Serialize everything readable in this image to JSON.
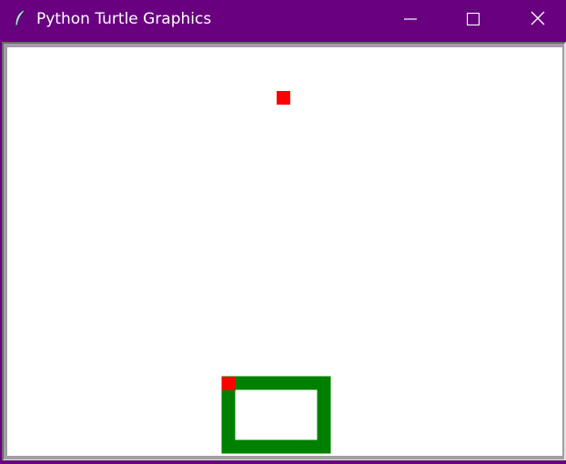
{
  "window": {
    "title": "Python Turtle Graphics",
    "frame_color": "#680080",
    "icons": {
      "app": "feather-icon",
      "minimize": "minimize-icon",
      "maximize": "maximize-icon",
      "close": "close-icon"
    }
  },
  "canvas": {
    "background": "#ffffff",
    "food_color": "#ff0000",
    "snake_head_color": "#ff0000",
    "snake_body_color": "#008000"
  }
}
